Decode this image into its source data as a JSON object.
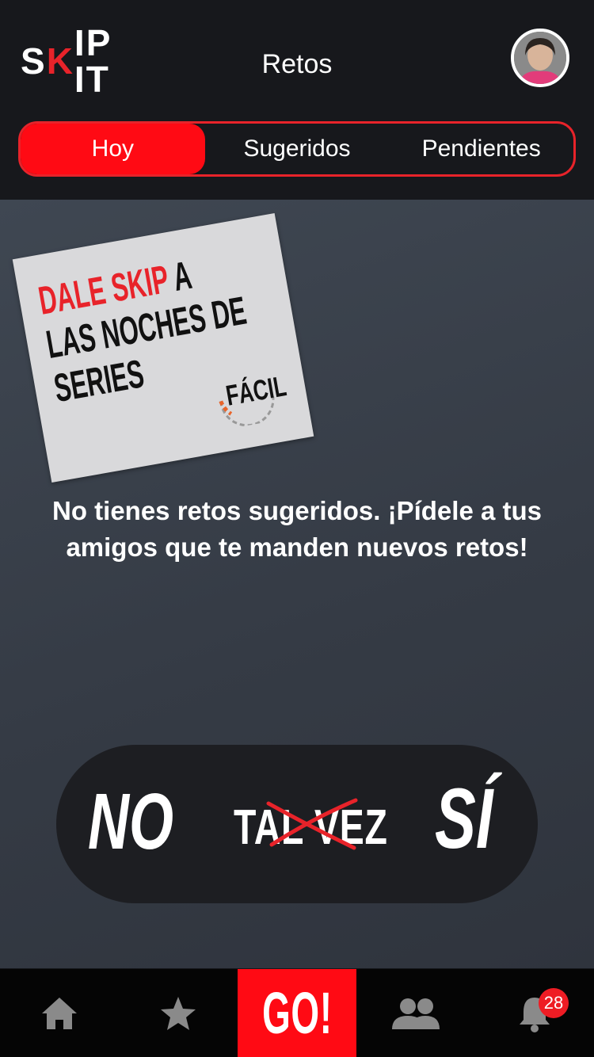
{
  "app": {
    "logo_text_1": "S",
    "logo_text_k": "K",
    "logo_text_2": "IP IT",
    "title": "Retos"
  },
  "tabs": [
    {
      "label": "Hoy",
      "active": true
    },
    {
      "label": "Sugeridos",
      "active": false
    },
    {
      "label": "Pendientes",
      "active": false
    }
  ],
  "challenge_card": {
    "line1_red": "DALE SKIP",
    "line1_black": " A",
    "line2": "LAS NOCHES DE",
    "line3": "SERIES",
    "difficulty": "FÁCIL"
  },
  "empty_message": "No tienes retos sugeridos. ¡Pídele a tus amigos que te manden nuevos retos!",
  "choices": {
    "no": "NO",
    "maybe": "TAL VEZ",
    "yes": "SÍ"
  },
  "bottom_nav": {
    "items": [
      {
        "icon": "home-icon"
      },
      {
        "icon": "star-icon"
      },
      {
        "label": "GO!"
      },
      {
        "icon": "friends-icon"
      },
      {
        "icon": "bell-icon",
        "badge": "28"
      }
    ]
  },
  "colors": {
    "accent": "#ff0a14",
    "header_bg": "#17181c",
    "main_bg": "#3b424c",
    "bar_bg": "#1d1e22"
  }
}
